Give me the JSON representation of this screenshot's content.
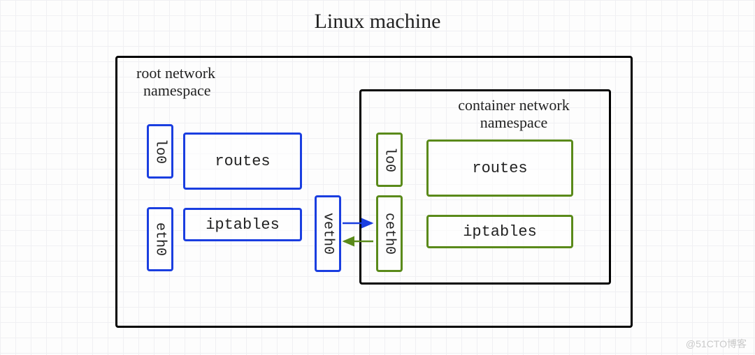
{
  "title": "Linux machine",
  "root_ns": {
    "label_line1": "root network",
    "label_line2": "namespace",
    "lo": "lo0",
    "eth": "eth0",
    "routes": "routes",
    "iptables": "iptables",
    "veth": "veth0"
  },
  "container_ns": {
    "label_line1": "container network",
    "label_line2": "namespace",
    "lo": "lo0",
    "ceth": "ceth0",
    "routes": "routes",
    "iptables": "iptables"
  },
  "colors": {
    "blue": "#1a3ee0",
    "green": "#5a8a1a",
    "black": "#000000"
  },
  "watermark": "@51CTO博客"
}
